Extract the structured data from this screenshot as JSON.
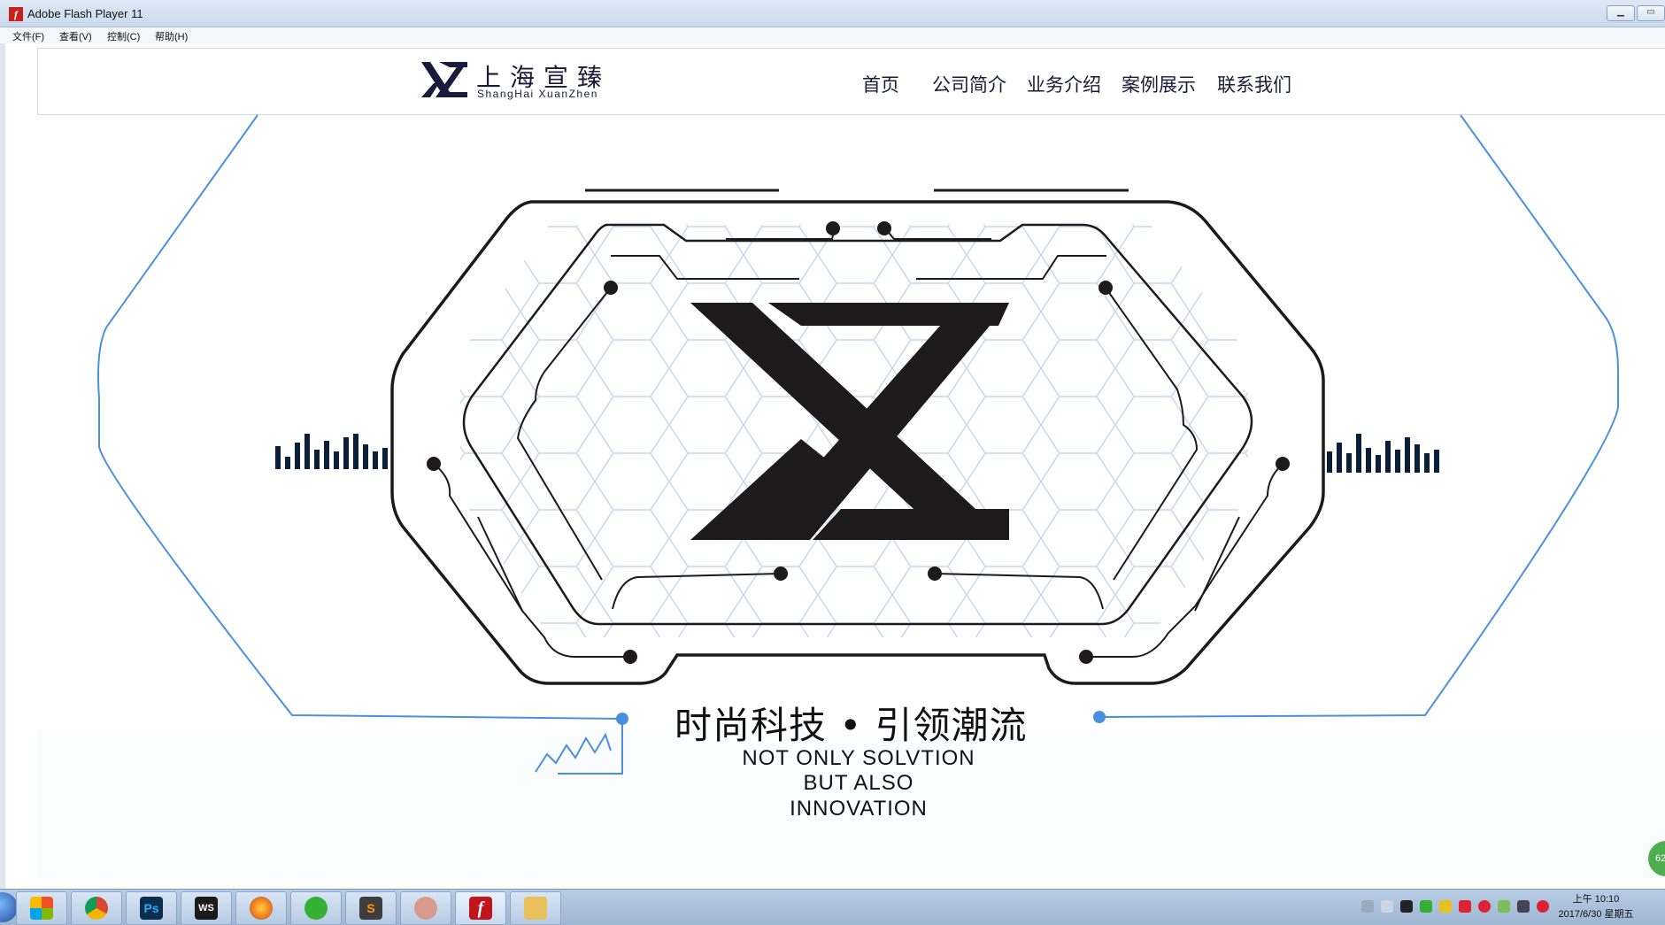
{
  "window": {
    "title": "Adobe Flash Player 11",
    "app_icon_glyph": "f",
    "controls": [
      "minimize-icon",
      "maximize-icon"
    ]
  },
  "menu": [
    {
      "label": "文件(F)"
    },
    {
      "label": "查看(V)"
    },
    {
      "label": "控制(C)"
    },
    {
      "label": "帮助(H)"
    }
  ],
  "site": {
    "logo_mark": "XZ",
    "logo_cn": "上海宣臻",
    "logo_en": "ShangHai XuanZhen",
    "nav": [
      {
        "label": "首页"
      },
      {
        "label": "公司简介"
      },
      {
        "label": "业务介绍"
      },
      {
        "label": "案例展示"
      },
      {
        "label": "联系我们"
      }
    ]
  },
  "hero": {
    "emblem": "XZ",
    "slogan_cn": "时尚科技 • 引领潮流",
    "slogan_en": [
      "NOT ONLY SOLVTION",
      "BUT ALSO",
      "INNOVATION"
    ]
  },
  "float_badge": "62",
  "taskbar": {
    "apps": [
      {
        "name": "chrome-icon",
        "color": "#e7453b"
      },
      {
        "name": "photoshop-icon",
        "color": "#0b2d4e",
        "glyph": "Ps"
      },
      {
        "name": "webstorm-icon",
        "color": "#1a1a1a",
        "glyph": "WS"
      },
      {
        "name": "firefox-icon",
        "color": "#f07a1c"
      },
      {
        "name": "wechat-icon",
        "color": "#35b035"
      },
      {
        "name": "sublime-icon",
        "color": "#3d3d3d",
        "glyph": "S"
      },
      {
        "name": "image-viewer-icon",
        "color": "#d99a8e"
      },
      {
        "name": "flash-player-icon",
        "color": "#c0161b",
        "glyph": "f"
      },
      {
        "name": "file-explorer-icon",
        "color": "#e8c15a"
      }
    ],
    "clock_time": "上午 10:10",
    "clock_date": "2017/6/30 星期五"
  },
  "colors": {
    "accent_blue": "#4a90e2",
    "hex_grid": "#b9d3ef",
    "ink": "#1c1a1a",
    "nav_text": "#1a1d3a"
  }
}
